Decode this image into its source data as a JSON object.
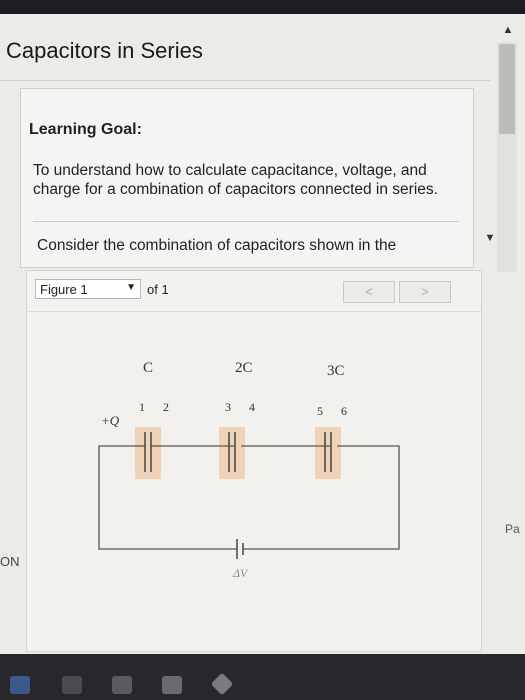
{
  "page": {
    "title": "Capacitors in Series",
    "side_text_right": "Pa",
    "side_text_left": "ON"
  },
  "goal": {
    "heading": "Learning Goal:",
    "text": "To understand how to calculate capacitance, voltage, and charge for a combination of capacitors connected in series.",
    "consider": "Consider the combination of capacitors shown in the"
  },
  "figure": {
    "select_label": "Figure 1",
    "of_label": "of 1",
    "prev_label": "<",
    "next_label": ">",
    "capacitors": [
      {
        "label": "C",
        "plates": [
          "1",
          "2"
        ]
      },
      {
        "label": "2C",
        "plates": [
          "3",
          "4"
        ]
      },
      {
        "label": "3C",
        "plates": [
          "5",
          "6"
        ]
      }
    ],
    "charge_label": "+Q",
    "voltage_label": "ΔV"
  },
  "colors": {
    "screen_bg": "#ecebe8",
    "capacitor_highlight": "#f0d2b6",
    "wire": "#444444"
  },
  "icons": {
    "scroll_up": "▲",
    "scroll_down": "▼",
    "dropdown": "▼"
  }
}
